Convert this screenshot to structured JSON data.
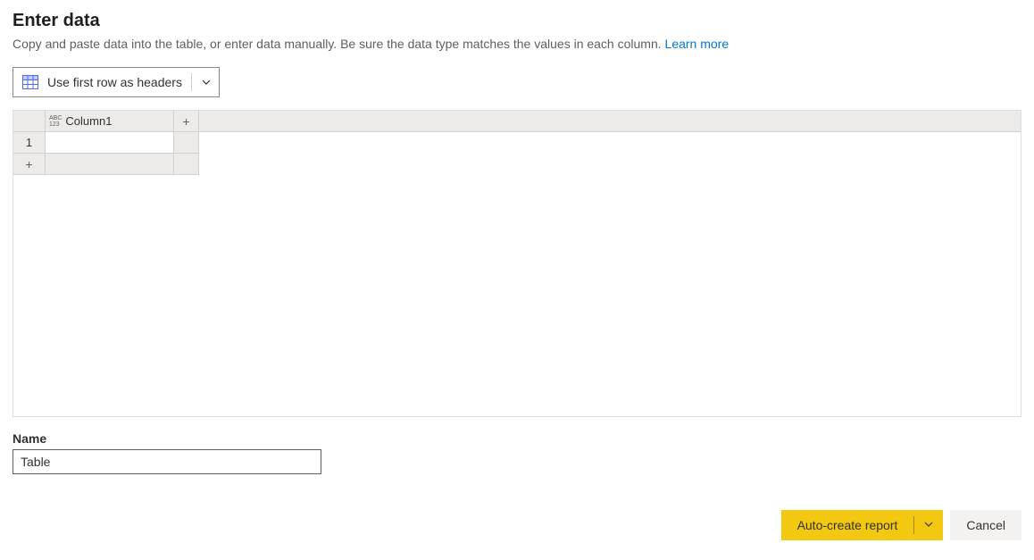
{
  "header": {
    "title": "Enter data",
    "subtitle": "Copy and paste data into the table, or enter data manually. Be sure the data type matches the values in each column. ",
    "learn_more": "Learn more"
  },
  "toolbar": {
    "use_first_row": "Use first row as headers"
  },
  "grid": {
    "type_label_top": "ABC",
    "type_label_bot": "123",
    "columns": [
      "Column1"
    ],
    "rows": [
      {
        "num": "1",
        "cells": [
          ""
        ]
      }
    ],
    "add_col": "+",
    "add_row": "+"
  },
  "name": {
    "label": "Name",
    "value": "Table"
  },
  "footer": {
    "auto_create": "Auto-create report",
    "cancel": "Cancel"
  }
}
